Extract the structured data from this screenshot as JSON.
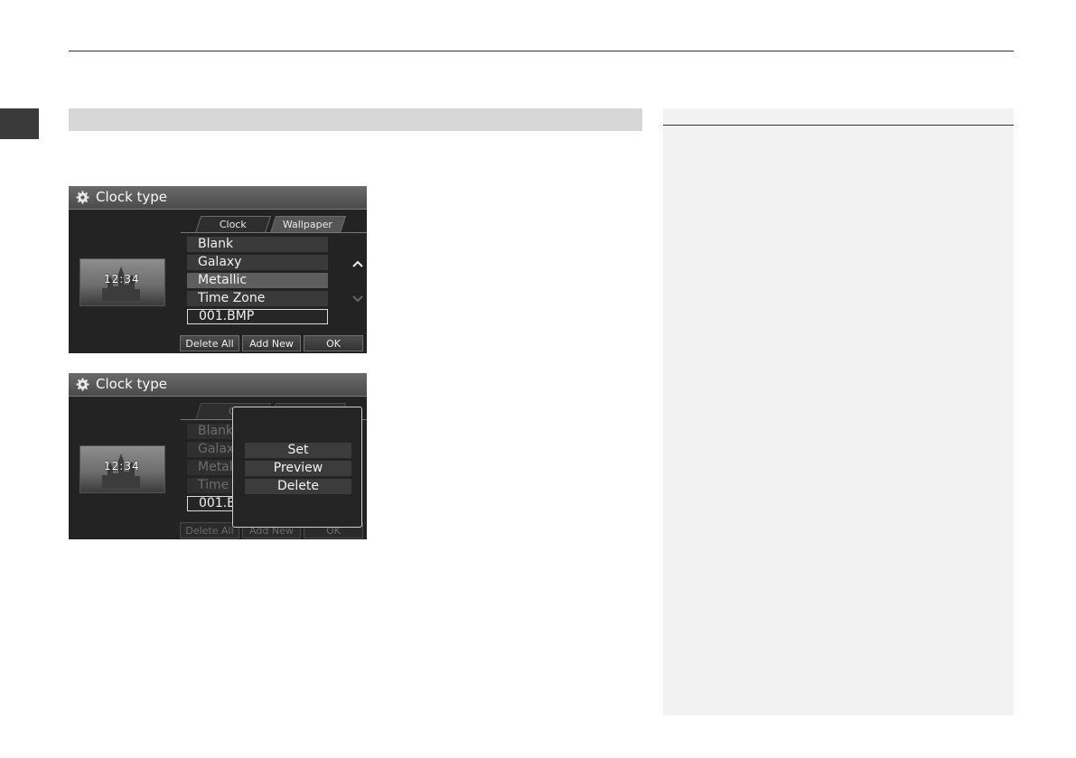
{
  "screen1": {
    "title": "Clock type",
    "tabs": [
      "Clock",
      "Wallpaper"
    ],
    "thumbnail_time": "12:34",
    "items": [
      "Blank",
      "Galaxy",
      "Metallic",
      "Time Zone",
      "001.BMP"
    ],
    "buttons": [
      "Delete All",
      "Add New",
      "OK"
    ]
  },
  "screen2": {
    "title": "Clock type",
    "tabs": [
      "Cl"
    ],
    "thumbnail_time": "12:34",
    "items": [
      "Blank",
      "Galax",
      "Metal",
      "Time",
      "001.B"
    ],
    "buttons": [
      "Delete All",
      "Add New",
      "OK"
    ],
    "popup": [
      "Set",
      "Preview",
      "Delete"
    ]
  },
  "icons": {
    "title": "gear-icon",
    "scroll_up": "chevron-up-icon",
    "scroll_down": "chevron-down-icon"
  }
}
